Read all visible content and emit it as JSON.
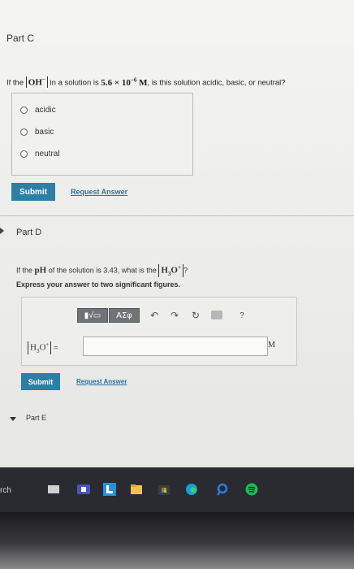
{
  "part_c": {
    "title": "Part C",
    "question_prefix": "If the",
    "ion": "OH",
    "ion_charge": "−",
    "question_mid": "in a solution is",
    "concentration": "5.6 × 10",
    "exponent": "−6",
    "unit": "M",
    "question_suffix": ", is this solution acidic, basic, or neutral?",
    "options": [
      "acidic",
      "basic",
      "neutral"
    ],
    "submit_label": "Submit",
    "request_answer_label": "Request Answer"
  },
  "part_d": {
    "title": "Part D",
    "question_prefix": "If the",
    "ph_label": "pH",
    "question_mid": "of the solution is 3.43, what is the",
    "ion": "H",
    "ion_sub": "3",
    "ion_o": "O",
    "ion_charge": "+",
    "question_suffix": "?",
    "instruction": "Express your answer to two significant figures.",
    "toolbar": {
      "template_label": "▮√▭",
      "symbols_label": "ΑΣφ",
      "undo_icon": "↶",
      "redo_icon": "↷",
      "reset_icon": "↻",
      "help_label": "?"
    },
    "answer_equals": "=",
    "unit": "M",
    "submit_label": "Submit",
    "request_answer_label": "Request Answer"
  },
  "part_e": {
    "title": "Part E"
  },
  "taskbar": {
    "search_text": "rch",
    "icons": [
      "task-view-icon",
      "teams-icon",
      "office-icon",
      "file-explorer-icon",
      "store-icon",
      "edge-icon",
      "search-app-icon",
      "spotify-icon"
    ]
  }
}
